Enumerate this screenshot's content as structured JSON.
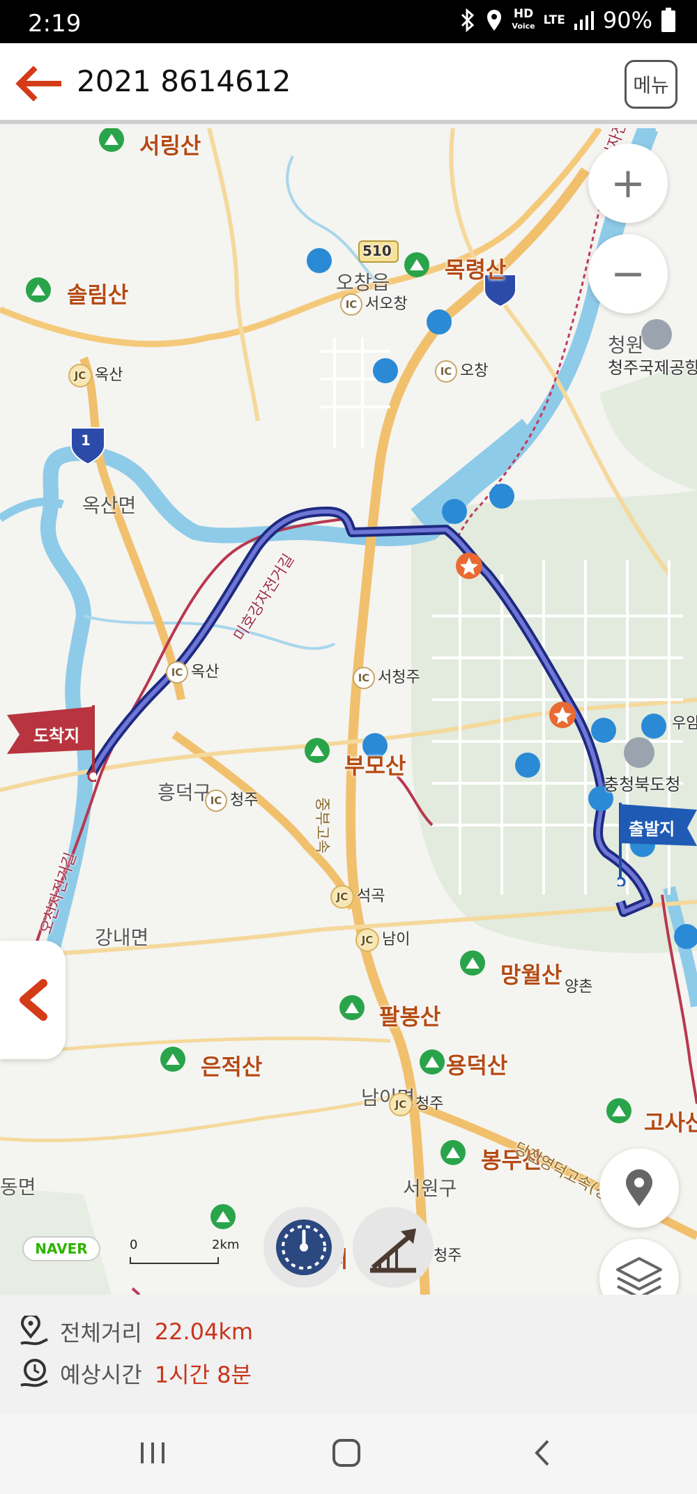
{
  "status_bar": {
    "time": "2:19",
    "battery": "90%",
    "hd_top": "HD",
    "hd_bottom": "Voice",
    "lte": "LTE"
  },
  "header": {
    "title": "2021 8614612",
    "menu_label": "메뉴"
  },
  "map": {
    "labels": {
      "seoringsan": "서링산",
      "sollimsan": "솔림산",
      "mokryeongsan": "목령산",
      "ochang_eup": "오창읍",
      "ochang_ic1": "서오창",
      "ochang_ic2": "오창",
      "oksan_jc": "옥산",
      "oksan_myeon": "옥산면",
      "oksan_ic": "옥산",
      "cheongwon": "청원",
      "airport": "청주국제공항",
      "road_510": "510",
      "seocheongju": "서청주",
      "bumosan": "부모산",
      "heungdeokgu": "흥덕구",
      "cheongju_ic": "청주",
      "woorim": "우암",
      "chungbuk": "충청북도청",
      "seokgok": "석곡",
      "nami": "남이",
      "gangnae": "강내면",
      "mangwolsan": "망월산",
      "yangchon": "양촌",
      "palbongsan": "팔봉산",
      "eunjeoksan": "은적산",
      "yongdeoksan": "용덕산",
      "namimyeon": "남이면",
      "cheongju_jc": "청주",
      "bongmusan": "봉무산",
      "seowongu": "서원구",
      "gosasan": "고사산",
      "dongmyeon": "동면",
      "cheongju_bottom": "청주",
      "jungbu_exp": "중부고속",
      "dangjin_exp": "당진영덕고속(청",
      "bike_path1": "오천자전거길",
      "bike_path2": "미호강자전거길",
      "bike_path3": "오천자전거길",
      "bottom_ri": "리",
      "ic_tag": "IC",
      "jc_tag": "JC",
      "route1": "1"
    },
    "start_flag": "출발지",
    "end_flag": "도착지",
    "scale_zero": "0",
    "scale_dist": "2km",
    "naver_logo": "NAVER"
  },
  "route_info": {
    "distance_label": "전체거리",
    "distance_value": "22.04km",
    "time_label": "예상시간",
    "time_value": "1시간 8분"
  },
  "colors": {
    "accent": "#c9341a",
    "route": "#3b3fa8",
    "water": "#8ecbe8",
    "road_major": "#f5c97a"
  }
}
